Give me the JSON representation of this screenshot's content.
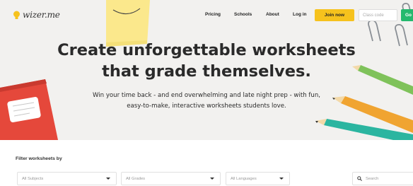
{
  "brand": {
    "logo_text": "wizer.me"
  },
  "nav": {
    "links": [
      "Pricing",
      "Schools",
      "About",
      "Log in"
    ],
    "join_label": "Join now",
    "class_code_placeholder": "Class code",
    "go_label": "Go"
  },
  "hero": {
    "headline_line1": "Create unforgettable worksheets",
    "headline_line2": "that grade themselves.",
    "subtitle_line1": "Win your time back - and end overwhelming and late night prep - with fun,",
    "subtitle_line2": "easy-to-make, interactive worksheets students love."
  },
  "filters": {
    "title": "Filter worksheets by",
    "subjects_value": "All Subjects",
    "grades_value": "All Grades",
    "languages_value": "All Languages",
    "search_placeholder": "Search"
  },
  "colors": {
    "hero_bg": "#f2f1ef",
    "join_yellow": "#f6c21d",
    "go_green": "#24b96e",
    "notebook_red": "#e5483b",
    "sticky_yellow": "#fbe88c"
  },
  "icons": [
    "lightbulb-icon",
    "search-icon",
    "chevron-down-icon",
    "paperclip-icon"
  ]
}
